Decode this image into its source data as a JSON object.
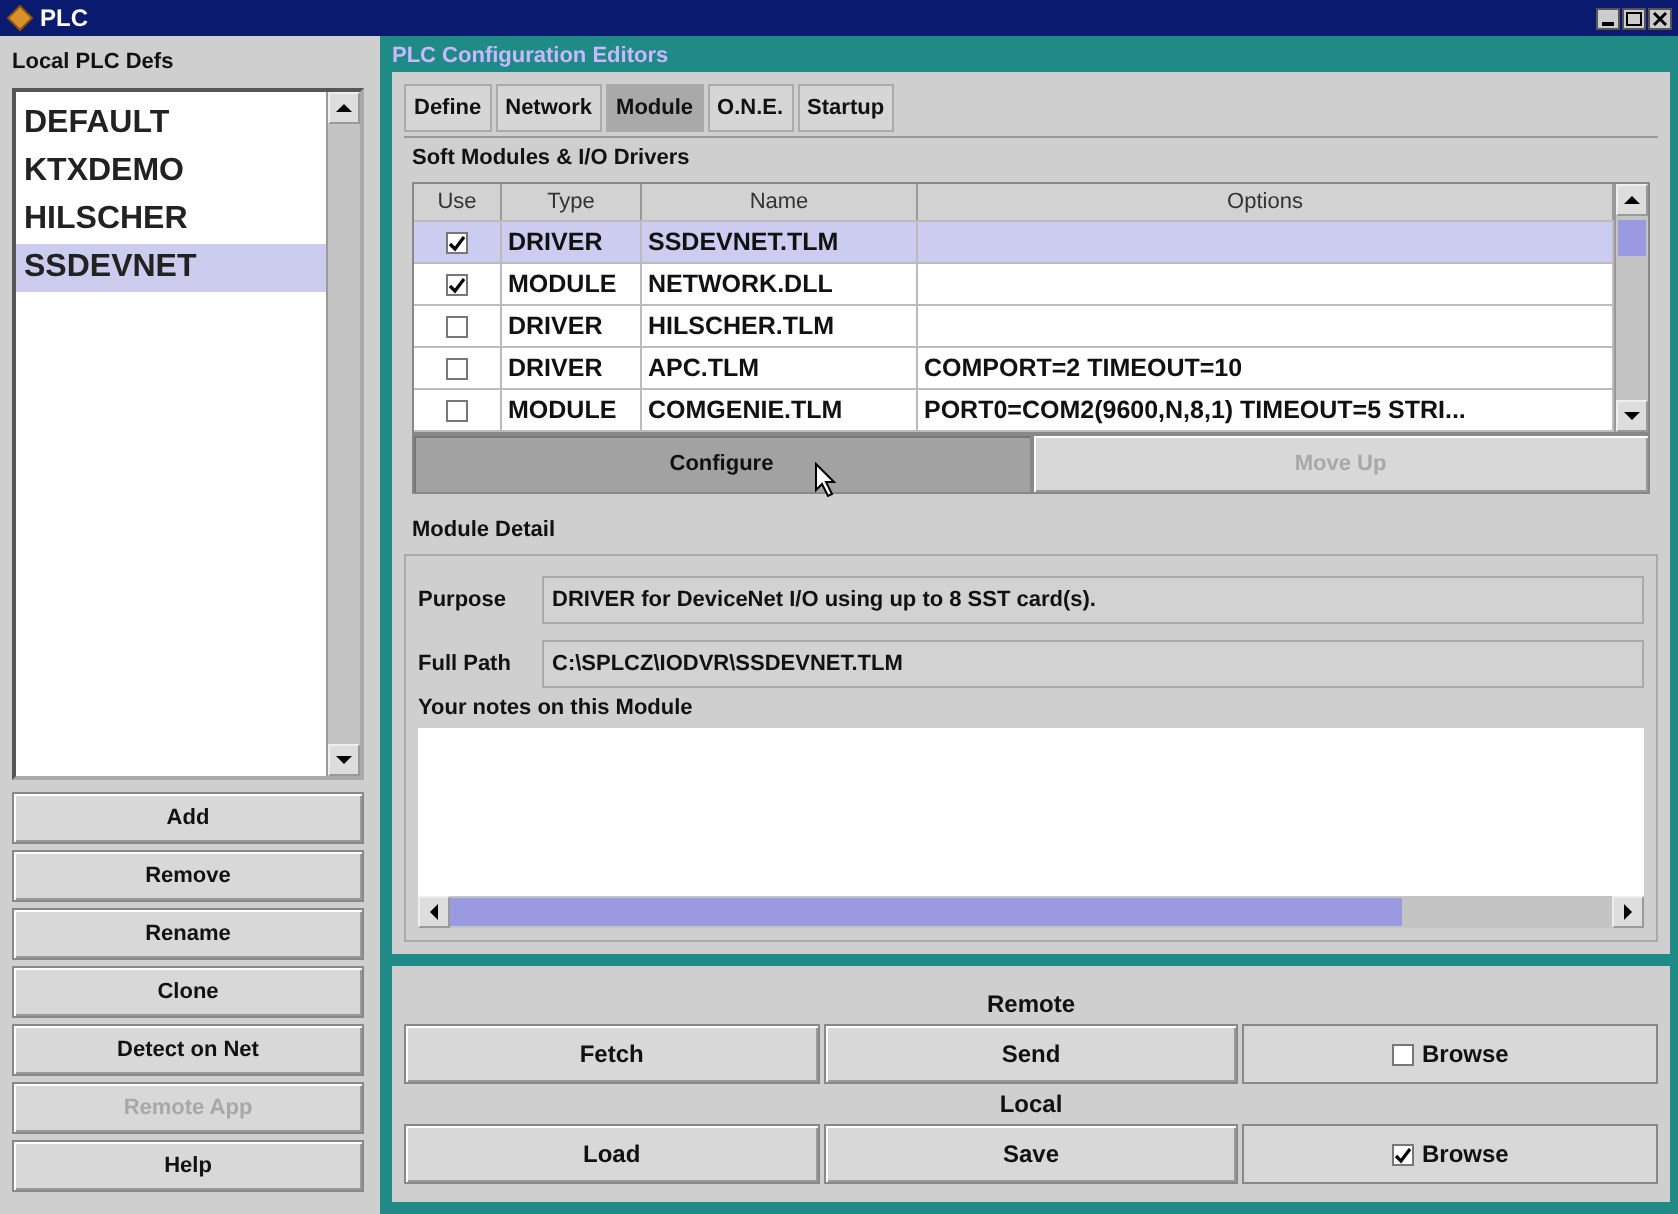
{
  "window": {
    "title": "PLC"
  },
  "local_defs": {
    "title": "Local PLC Defs",
    "items": [
      {
        "label": "DEFAULT",
        "selected": false
      },
      {
        "label": "KTXDEMO",
        "selected": false
      },
      {
        "label": "HILSCHER",
        "selected": false
      },
      {
        "label": "SSDEVNET",
        "selected": true
      }
    ],
    "buttons": [
      {
        "label": "Add",
        "disabled": false
      },
      {
        "label": "Remove",
        "disabled": false
      },
      {
        "label": "Rename",
        "disabled": false
      },
      {
        "label": "Clone",
        "disabled": false
      },
      {
        "label": "Detect on Net",
        "disabled": false
      },
      {
        "label": "Remote App",
        "disabled": true
      },
      {
        "label": "Help",
        "disabled": false
      }
    ]
  },
  "editors": {
    "title": "PLC Configuration Editors",
    "tabs": [
      {
        "label": "Define",
        "selected": false
      },
      {
        "label": "Network",
        "selected": false
      },
      {
        "label": "Module",
        "selected": true
      },
      {
        "label": "O.N.E.",
        "selected": false
      },
      {
        "label": "Startup",
        "selected": false
      }
    ],
    "modules": {
      "title": "Soft Modules & I/O Drivers",
      "columns": [
        "Use",
        "Type",
        "Name",
        "Options"
      ],
      "rows": [
        {
          "checked": true,
          "type": "DRIVER",
          "name": "SSDEVNET.TLM",
          "options": "",
          "selected": true
        },
        {
          "checked": true,
          "type": "MODULE",
          "name": "NETWORK.DLL",
          "options": "",
          "selected": false
        },
        {
          "checked": false,
          "type": "DRIVER",
          "name": "HILSCHER.TLM",
          "options": "",
          "selected": false
        },
        {
          "checked": false,
          "type": "DRIVER",
          "name": "APC.TLM",
          "options": "COMPORT=2 TIMEOUT=10",
          "selected": false
        },
        {
          "checked": false,
          "type": "MODULE",
          "name": "COMGENIE.TLM",
          "options": "PORT0=COM2(9600,N,8,1) TIMEOUT=5  STRI...",
          "selected": false
        }
      ],
      "actions": [
        {
          "label": "Configure",
          "pressed": true,
          "disabled": false
        },
        {
          "label": "Move Up",
          "pressed": false,
          "disabled": true
        }
      ]
    },
    "detail": {
      "title": "Module Detail",
      "fields": [
        {
          "label": "Purpose",
          "value": "DRIVER for DeviceNet I/O using up to 8 SST card(s)."
        },
        {
          "label": "Full Path",
          "value": "C:\\SPLCZ\\IODVR\\SSDEVNET.TLM"
        }
      ],
      "notes_title": "Your notes on this Module"
    }
  },
  "transfer": [
    {
      "title": "Remote",
      "buttons": [
        "Fetch",
        "Send"
      ],
      "browse": {
        "label": "Browse",
        "checked": false
      }
    },
    {
      "title": "Local",
      "buttons": [
        "Load",
        "Save"
      ],
      "browse": {
        "label": "Browse",
        "checked": true
      }
    }
  ]
}
